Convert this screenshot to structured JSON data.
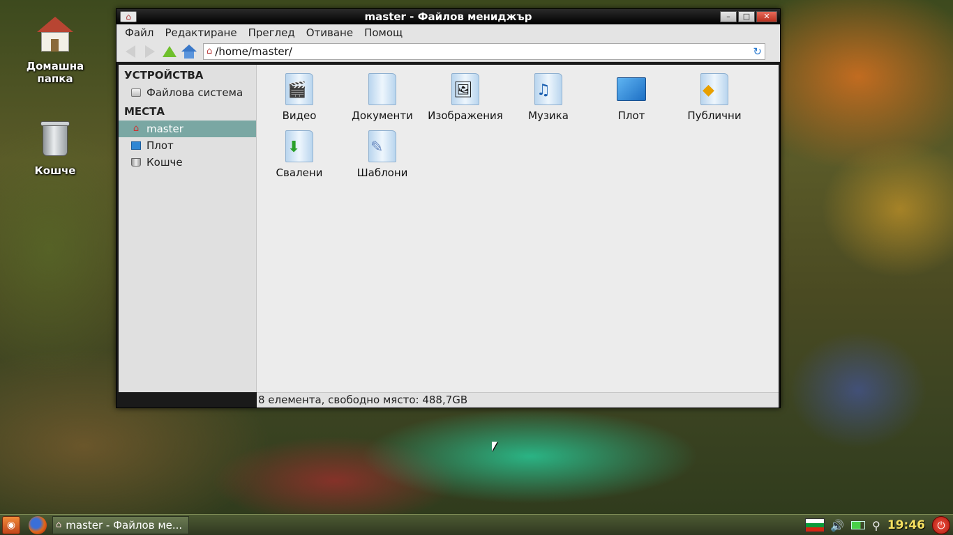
{
  "desktop": {
    "icons": [
      {
        "label": "Домашна папка"
      },
      {
        "label": "Кошче"
      }
    ]
  },
  "window": {
    "title": "master - Файлов мениджър",
    "controls": {
      "minimize": "–",
      "maximize": "□",
      "close": "✕"
    }
  },
  "menubar": {
    "items": [
      "Файл",
      "Редактиране",
      "Преглед",
      "Отиване",
      "Помощ"
    ]
  },
  "toolbar": {
    "location": "/home/master/"
  },
  "sidebar": {
    "devices_header": "УСТРОЙСТВА",
    "devices": [
      {
        "label": "Файлова система",
        "icon": "drive-icon"
      }
    ],
    "places_header": "МЕСТА",
    "places": [
      {
        "label": "master",
        "icon": "home-icon",
        "selected": true
      },
      {
        "label": "Плот",
        "icon": "desktop-icon"
      },
      {
        "label": "Кошче",
        "icon": "trash-icon"
      }
    ]
  },
  "files": [
    {
      "label": "Видео",
      "icon": "video-folder-icon"
    },
    {
      "label": "Документи",
      "icon": "documents-folder-icon"
    },
    {
      "label": "Изображения",
      "icon": "pictures-folder-icon"
    },
    {
      "label": "Музика",
      "icon": "music-folder-icon"
    },
    {
      "label": "Плот",
      "icon": "desktop-folder-icon"
    },
    {
      "label": "Публични",
      "icon": "public-folder-icon"
    },
    {
      "label": "Свалени",
      "icon": "downloads-folder-icon"
    },
    {
      "label": "Шаблони",
      "icon": "templates-folder-icon"
    }
  ],
  "statusbar": {
    "text": "8 елемента, свободно място: 488,7GB"
  },
  "taskbar": {
    "task_label": "master - Файлов ме...",
    "clock": "19:46"
  }
}
